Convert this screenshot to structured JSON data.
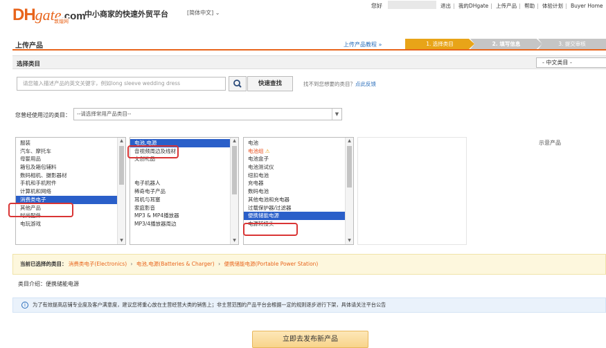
{
  "header": {
    "logo_main": "DHgate",
    "logo_suffix": ".com",
    "logo_sub": "敦煌网",
    "slogan": "中小商家的快速外贸平台",
    "language": "[简体中文] ⌄",
    "greeting": "您好",
    "links": [
      "退出",
      "我的DHgate",
      "上传产品",
      "帮助",
      "体验计划",
      "Buyer Home"
    ]
  },
  "page": {
    "title": "上传产品",
    "tutorial_link": "上传产品教程 »",
    "steps": [
      "1. 选择类目",
      "2. 填写信息",
      "3. 提交审核"
    ]
  },
  "select_category": {
    "label": "选择类目",
    "category_lang": "- 中文类目 -"
  },
  "search": {
    "placeholder": "请您输入描述产品的英文关键字，例如long sleeve wedding dress",
    "button": "快速查找",
    "feedback_prefix": "找不到您想要的类目？",
    "feedback_link": "点此反馈"
  },
  "used_categories": {
    "label": "您曾经使用过的类目：",
    "placeholder": "--请选择常用产品类目--"
  },
  "lists": {
    "level1": [
      "服装",
      "汽车、摩托车",
      "母婴用品",
      "箱包及箱包辅料",
      "数码相机、摄影器材",
      "手机和手机附件",
      "计算机和网络",
      "消费类电子",
      "其他产品",
      "时尚配件",
      "电玩游戏"
    ],
    "level1_selected": 7,
    "level2": [
      "电池,电源",
      "音视频周边及线材",
      "文创礼品",
      "",
      "",
      "电子机器人",
      "稀奇电子产品",
      "耳机与耳塞",
      "家庭影音",
      "MP3 & MP4播放器",
      "MP3/4播放器周边"
    ],
    "level2_selected": 0,
    "level3": [
      "电池",
      "电池组",
      "电池盒子",
      "电池测试仪",
      "纽扣电池",
      "充电器",
      "数码电池",
      "其他电池和充电器",
      "过载保护器/过滤器",
      "便携储能电源",
      "电源转接头"
    ],
    "level3_selected": 9,
    "level3_warning_index": 1
  },
  "preview": {
    "label": "示意产品"
  },
  "current_selection": {
    "label": "当前已选择的类目：",
    "path": [
      "消费类电子(Electronics)",
      "电池,电源(Batteries & Charger)",
      "便携储能电源(Portable Power Station)"
    ],
    "separator": "›"
  },
  "intro": {
    "label": "类目介绍：",
    "value": "便携储能电源"
  },
  "notice": {
    "text": "为了有效提高店铺专业度及客户满意度，建议您将重心放在主营经营大类的销售上；非主营范围的产品平台会根据一定的规则逐步进行下架，具体请关注平台公告"
  },
  "publish_button": "立即去发布新产品",
  "colors": {
    "brand": "#e8641b",
    "selection": "#2a5fc9",
    "highlight": "#d93434"
  }
}
